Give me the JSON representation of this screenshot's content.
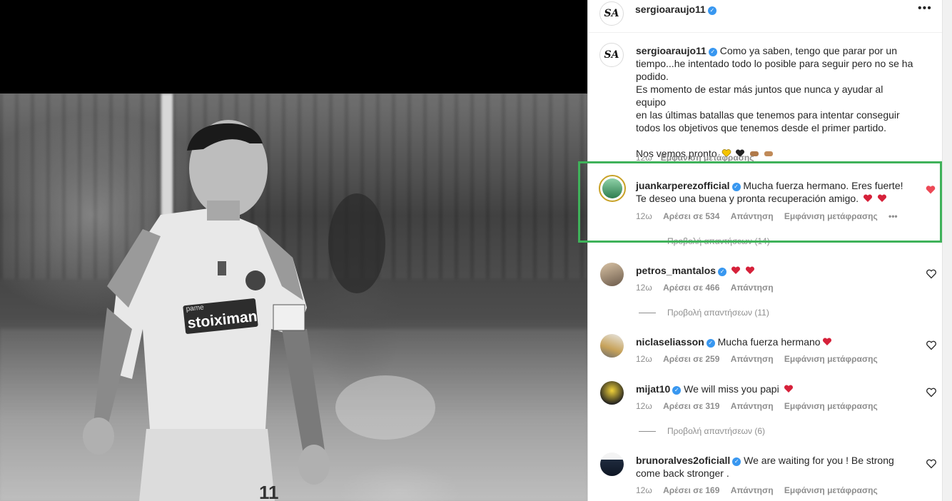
{
  "post": {
    "author": "sergioaraujo11",
    "author_avatar_text": "SA",
    "caption_lines": [
      "Como ya saben, tengo que parar por un",
      "tiempo...he intentado todo lo posible para seguir pero no se ha",
      "podido.",
      "Es momento de estar más juntos que nunca y ayudar al equipo",
      "en las últimas batallas que tenemos para intentar conseguir",
      "todos los objetivos que tenemos desde el primer partido.",
      "",
      "Nos vemos pronto"
    ],
    "caption_time": "12ω",
    "caption_translate": "Εμφάνιση μετάφρασης"
  },
  "comments": [
    {
      "user": "juankarperezofficial",
      "text": "Mucha fuerza hermano. Eres fuerte! Te deseo una buena y pronta recuperación amigo.",
      "time": "12ω",
      "likes": "Αρέσει σε 534",
      "reply": "Απάντηση",
      "translate": "Εμφάνιση μετάφρασης",
      "replies": "Προβολή απαντήσεων (14)",
      "liked": true
    },
    {
      "user": "petros_mantalos",
      "text": "",
      "time": "12ω",
      "likes": "Αρέσει σε 466",
      "reply": "Απάντηση",
      "replies": "Προβολή απαντήσεων (11)",
      "liked": false
    },
    {
      "user": "niclaseliasson",
      "text": "Mucha fuerza hermano",
      "time": "12ω",
      "likes": "Αρέσει σε 259",
      "reply": "Απάντηση",
      "translate": "Εμφάνιση μετάφρασης",
      "liked": false
    },
    {
      "user": "mijat10",
      "text": "We will miss you papi",
      "time": "12ω",
      "likes": "Αρέσει σε 319",
      "reply": "Απάντηση",
      "translate": "Εμφάνιση μετάφρασης",
      "replies": "Προβολή απαντήσεων (6)",
      "liked": false
    },
    {
      "user": "brunoralves2oficiall",
      "text": "We are waiting for you ! Be strong come back stronger .",
      "time": "12ω",
      "likes": "Αρέσει σε 169",
      "reply": "Απάντηση",
      "translate": "Εμφάνιση μετάφρασης",
      "liked": false
    }
  ],
  "photo": {
    "sponsor_text": "stoiximan",
    "sponsor_small": "pame",
    "shirt_number": "11"
  },
  "colors": {
    "highlight": "#3fb25a",
    "verified": "#3897f0",
    "liked_heart": "#ed4956",
    "muted_text": "#8e8e8e"
  },
  "icons": {
    "more": "more-horizontal-icon",
    "verified": "verified-badge-icon",
    "like": "heart-icon"
  }
}
